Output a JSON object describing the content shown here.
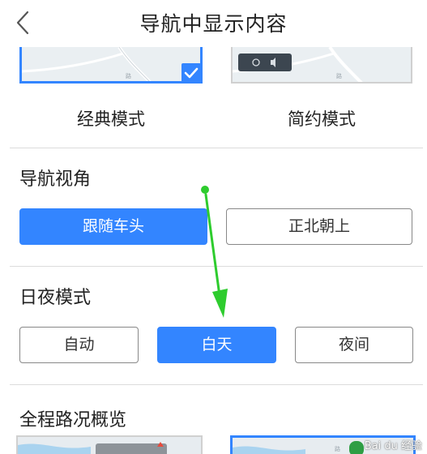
{
  "header": {
    "title": "导航中显示内容"
  },
  "display_style": {
    "options": [
      {
        "label": "经典模式",
        "selected": true
      },
      {
        "label": "简约模式",
        "selected": false
      }
    ]
  },
  "nav_view": {
    "title": "导航视角",
    "options": [
      {
        "label": "跟随车头",
        "selected": true
      },
      {
        "label": "正北朝上",
        "selected": false
      }
    ]
  },
  "day_night": {
    "title": "日夜模式",
    "options": [
      {
        "label": "自动",
        "selected": false
      },
      {
        "label": "白天",
        "selected": true
      },
      {
        "label": "夜间",
        "selected": false
      }
    ]
  },
  "overview": {
    "title": "全程路况概览"
  },
  "annotation": {
    "arrow_color": "#2ecc2e"
  },
  "colors": {
    "accent": "#3385ff"
  },
  "watermark": {
    "text": "Bai du 经验"
  }
}
